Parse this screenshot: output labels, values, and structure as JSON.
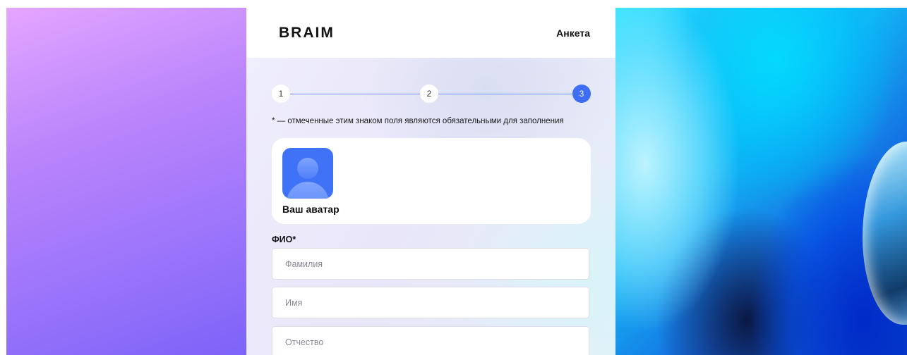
{
  "header": {
    "logo": "BRAIM",
    "title": "Анкета"
  },
  "stepper": {
    "steps": [
      "1",
      "2",
      "3"
    ],
    "active_step": 3,
    "active_color": "#3d6ef5"
  },
  "form": {
    "required_note": "* — отмеченные этим знаком поля являются обязательными для заполнения",
    "avatar": {
      "label": "Ваш аватар",
      "icon": "user-placeholder-icon",
      "color": "#3f72f6"
    },
    "fio": {
      "label": "ФИО*",
      "last_name_placeholder": "Фамилия",
      "first_name_placeholder": "Имя",
      "middle_name_placeholder": "Отчество"
    }
  }
}
